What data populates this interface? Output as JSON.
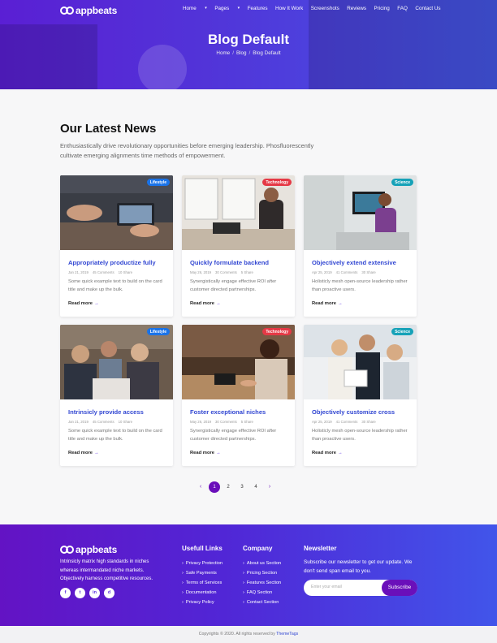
{
  "brand": {
    "name": "appbeats"
  },
  "nav": {
    "items": [
      {
        "label": "Home",
        "caret": true
      },
      {
        "label": "Pages",
        "caret": true
      },
      {
        "label": "Features",
        "caret": false
      },
      {
        "label": "How It Work",
        "caret": false
      },
      {
        "label": "Screenshots",
        "caret": false
      },
      {
        "label": "Reviews",
        "caret": false
      },
      {
        "label": "Pricing",
        "caret": false
      },
      {
        "label": "FAQ",
        "caret": false
      },
      {
        "label": "Contact Us",
        "caret": false
      }
    ]
  },
  "hero": {
    "title": "Blog Default",
    "breadcrumbs": [
      "Home",
      "Blog",
      "Blog Default"
    ],
    "separator": "/"
  },
  "intro": {
    "title": "Our Latest News",
    "description": "Enthusiastically drive revolutionary opportunities before emerging leadership. Phosfluorescently cultivate emerging alignments time methods of empowerment."
  },
  "cards": [
    {
      "tag": "Lifestyle",
      "tag_color": "#1a73e8",
      "title": "Appropriately productize fully",
      "date": "Jan 21, 2019",
      "comments": "45 Comments",
      "shares": "10 Share",
      "text": "Some quick example text to build on the card title and make up the bulk.",
      "read_more": "Read more"
    },
    {
      "tag": "Technology",
      "tag_color": "#e53946",
      "title": "Quickly formulate backend",
      "date": "May 26, 2019",
      "comments": "30 Comments",
      "shares": "5 Share",
      "text": "Synergistically engage effective ROI after customer directed partnerships.",
      "read_more": "Read more"
    },
    {
      "tag": "Science",
      "tag_color": "#17a2b8",
      "title": "Objectively extend extensive",
      "date": "Apr 25, 2019",
      "comments": "41 Comments",
      "shares": "30 Share",
      "text": "Holisticly mesh open-source leadership rather than proactive users.",
      "read_more": "Read more"
    },
    {
      "tag": "Lifestyle",
      "tag_color": "#1a73e8",
      "title": "Intrinsicly provide access",
      "date": "Jan 21, 2019",
      "comments": "45 Comments",
      "shares": "10 Share",
      "text": "Some quick example text to build on the card title and make up the bulk.",
      "read_more": "Read more"
    },
    {
      "tag": "Technology",
      "tag_color": "#e53946",
      "title": "Foster exceptional niches",
      "date": "May 26, 2019",
      "comments": "30 Comments",
      "shares": "5 Share",
      "text": "Synergistically engage effective ROI after customer directed partnerships.",
      "read_more": "Read more"
    },
    {
      "tag": "Science",
      "tag_color": "#17a2b8",
      "title": "Objectively customize cross",
      "date": "Apr 25, 2019",
      "comments": "41 Comments",
      "shares": "30 Share",
      "text": "Holisticly mesh open-source leadership rather than proactive users.",
      "read_more": "Read more"
    }
  ],
  "pagination": {
    "pages": [
      "1",
      "2",
      "3",
      "4"
    ],
    "current": "1",
    "prev": "‹",
    "next": "›"
  },
  "footer": {
    "about": "Intrinsicly matrix high standards in niches whereas intermandated niche markets. Objectively harness competitive resources.",
    "socials": [
      "f",
      "t",
      "in",
      "d"
    ],
    "useful_links": {
      "title": "Usefull Links",
      "links": [
        "Privacy Protection",
        "Safe Payments",
        "Terms of Services",
        "Documentation",
        "Privacy Policy"
      ]
    },
    "company": {
      "title": "Company",
      "links": [
        "About us Section",
        "Pricing Section",
        "Features Section",
        "FAQ Section",
        "Contact Section"
      ]
    },
    "newsletter": {
      "title": "Newsletter",
      "text": "Subscribe our newsletter to get our update. We don't send span email to you.",
      "placeholder": "Enter your email",
      "button": "Subscribe"
    }
  },
  "copyright": {
    "text": "Copyrights © 2020. All rights reserved by",
    "brand": "ThemeTags"
  },
  "colors": {
    "accent": "#6a0fba",
    "link": "#3247d2",
    "hero_start": "#5a1fd4",
    "hero_end": "#4457e6"
  }
}
